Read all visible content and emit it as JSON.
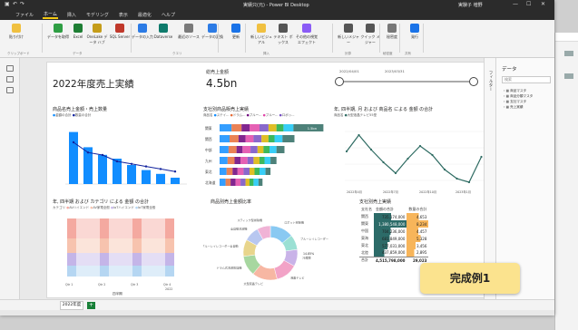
{
  "window": {
    "title": "実績只(元) - Power BI Desktop",
    "user": "実験子 増野"
  },
  "menu": [
    "ファイル",
    "ホーム",
    "挿入",
    "モデリング",
    "表示",
    "最適化",
    "ヘルプ"
  ],
  "menu_active": 1,
  "ribbon": {
    "buttons": [
      "貼り付け",
      "データを取得",
      "Excel",
      "OneLake データ ハブ",
      "SQL Server",
      "データの入力",
      "Dataverse",
      "最近のソース",
      "データの変換",
      "更新",
      "新しいビジュアル",
      "テキスト ボックス",
      "その他の視覚エフェクト",
      "新しいメジャー",
      "クイック メジャー",
      "秘密度",
      "発行"
    ],
    "groups": [
      "クリップボード",
      "データ",
      "クエリ",
      "挿入",
      "計算",
      "秘密度",
      "共有"
    ]
  },
  "right": {
    "filter_label": "フィルター",
    "data_label": "データ",
    "search_placeholder": "検索",
    "fields": [
      "商品マスタ",
      "商品分類マスタ",
      "支社マスタ",
      "売上実績"
    ]
  },
  "pages": {
    "tab": "2022年度",
    "add": "+"
  },
  "report": {
    "title": "2022年度売上実績",
    "card_label": "総売上金額",
    "card_value": "4.5bn",
    "slicer_from": "2022/04/01",
    "slicer_to": "2023/03/31",
    "badge": "完成例1"
  },
  "visual1": {
    "title": "商品名売上金額・売上数量",
    "legend": [
      "金額の合計",
      "数量の合計"
    ]
  },
  "visual2": {
    "title": "支社別商品販売上実績",
    "legend_prefix": "商品名",
    "legend": [
      "ステイ...",
      "ドラム...",
      "ブルー...",
      "ブルー...",
      "ロボッ..."
    ],
    "categories": [
      "関東",
      "関西",
      "中部",
      "九州",
      "東北",
      "北海道"
    ],
    "top_label": "1.5bn"
  },
  "visual3": {
    "title": "年, 四半期, 月 および 商品名 による 金額 の合計",
    "legend_prefix": "商品名",
    "legend": [
      "大型液晶テレビ55型"
    ],
    "axis": [
      "2022年4月",
      "2022年7月",
      "2022年10月",
      "2023年1月"
    ]
  },
  "visual4": {
    "title": "年, 四半期 および カテゴリ による 金額 の合計",
    "legend_prefix": "カテゴリ",
    "legend": [
      "AVハイエンド",
      "AV家電全般",
      "IoTハイエンド",
      "IoT家電全般"
    ],
    "axis": [
      "Qtr 1",
      "Qtr 2",
      "Qtr 3",
      "Qtr 4"
    ],
    "axis_year": "2022",
    "xlabel": "四半期"
  },
  "visual5": {
    "title": "商品別売上金額比率",
    "slices": [
      "ロボット掃除機",
      "ブルーレイレコーダー",
      "冷蔵庫",
      "液晶テレビ",
      "大型液晶テレビ",
      "ドラム式洗濯乾燥機",
      "ブルーレイレコーダー全自動",
      "全自動洗濯機",
      "スティック型掃除機"
    ],
    "pct_label": "14.85%"
  },
  "visual6": {
    "title": "支社別売上実績",
    "headers": [
      "支社名",
      "金額の合計",
      "数量の合計"
    ],
    "rows": [
      {
        "name": "関西",
        "amount": "735,174,000",
        "qty": "4,653"
      },
      {
        "name": "関東",
        "amount": "1,380,548,000",
        "qty": "8,234"
      },
      {
        "name": "中国",
        "amount": "704,236,000",
        "qty": "4,457"
      },
      {
        "name": "東海",
        "amount": "681,849,000",
        "qty": "5,328"
      },
      {
        "name": "東北",
        "amount": "577,031,000",
        "qty": "3,456"
      },
      {
        "name": "北陸",
        "amount": "437,859,000",
        "qty": "2,895"
      }
    ],
    "total": {
      "name": "合計",
      "amount": "4,515,798,000",
      "qty": "29,023"
    }
  },
  "colors": {
    "accent": "#f2c811",
    "bar_blue": "#118dff",
    "line_dark": "#12239e",
    "teal": "#2e6b62",
    "table_teal": "#2c6b68",
    "table_orange": "#f7b55a"
  }
}
